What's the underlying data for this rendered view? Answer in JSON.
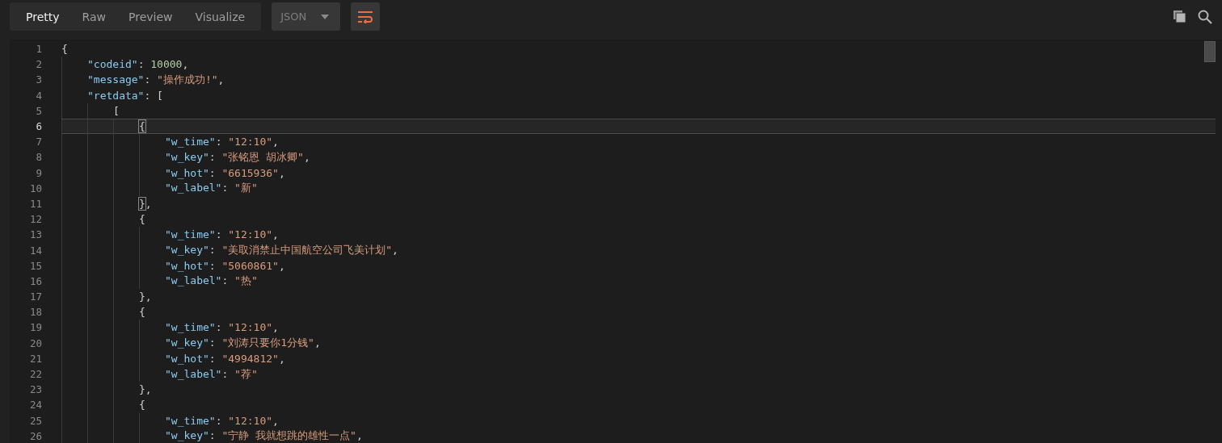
{
  "tabs": [
    {
      "label": "Pretty",
      "selected": true
    },
    {
      "label": "Raw",
      "selected": false
    },
    {
      "label": "Preview",
      "selected": false
    },
    {
      "label": "Visualize",
      "selected": false
    }
  ],
  "format_dropdown": {
    "value": "JSON"
  },
  "wrap_button": {
    "on": true
  },
  "code": {
    "lines": [
      {
        "number": "1",
        "current": false,
        "tokens": [
          {
            "kind": "punct",
            "text": "{"
          }
        ],
        "children": [
          {
            "number": "2",
            "current": false,
            "tokens": [
              {
                "kind": "key",
                "text": "\"codeid\""
              },
              {
                "kind": "punct",
                "text": ": "
              },
              {
                "kind": "number",
                "text": "10000"
              },
              {
                "kind": "punct",
                "text": ","
              }
            ]
          },
          {
            "number": "3",
            "current": false,
            "tokens": [
              {
                "kind": "key",
                "text": "\"message\""
              },
              {
                "kind": "punct",
                "text": ": "
              },
              {
                "kind": "string",
                "text": "\"操作成功!\""
              },
              {
                "kind": "punct",
                "text": ","
              }
            ]
          },
          {
            "number": "4",
            "current": false,
            "tokens": [
              {
                "kind": "key",
                "text": "\"retdata\""
              },
              {
                "kind": "punct",
                "text": ": ["
              }
            ],
            "children": [
              {
                "number": "5",
                "current": false,
                "tokens": [
                  {
                    "kind": "punct",
                    "text": "["
                  }
                ],
                "children": [
                  {
                    "number": "6",
                    "current": true,
                    "tokens": [
                      {
                        "kind": "match",
                        "text": "{"
                      }
                    ],
                    "children": [
                      {
                        "number": "7",
                        "current": false,
                        "tokens": [
                          {
                            "kind": "key",
                            "text": "\"w_time\""
                          },
                          {
                            "kind": "punct",
                            "text": ": "
                          },
                          {
                            "kind": "string",
                            "text": "\"12:10\""
                          },
                          {
                            "kind": "punct",
                            "text": ","
                          }
                        ]
                      },
                      {
                        "number": "8",
                        "current": false,
                        "tokens": [
                          {
                            "kind": "key",
                            "text": "\"w_key\""
                          },
                          {
                            "kind": "punct",
                            "text": ": "
                          },
                          {
                            "kind": "string",
                            "text": "\"张铭恩 胡冰卿\""
                          },
                          {
                            "kind": "punct",
                            "text": ","
                          }
                        ]
                      },
                      {
                        "number": "9",
                        "current": false,
                        "tokens": [
                          {
                            "kind": "key",
                            "text": "\"w_hot\""
                          },
                          {
                            "kind": "punct",
                            "text": ": "
                          },
                          {
                            "kind": "string",
                            "text": "\"6615936\""
                          },
                          {
                            "kind": "punct",
                            "text": ","
                          }
                        ]
                      },
                      {
                        "number": "10",
                        "current": false,
                        "tokens": [
                          {
                            "kind": "key",
                            "text": "\"w_label\""
                          },
                          {
                            "kind": "punct",
                            "text": ": "
                          },
                          {
                            "kind": "string",
                            "text": "\"新\""
                          }
                        ]
                      }
                    ]
                  },
                  {
                    "number": "11",
                    "current": false,
                    "tokens": [
                      {
                        "kind": "match",
                        "text": "}"
                      },
                      {
                        "kind": "punct",
                        "text": ","
                      }
                    ]
                  },
                  {
                    "number": "12",
                    "current": false,
                    "tokens": [
                      {
                        "kind": "punct",
                        "text": "{"
                      }
                    ],
                    "children": [
                      {
                        "number": "13",
                        "current": false,
                        "tokens": [
                          {
                            "kind": "key",
                            "text": "\"w_time\""
                          },
                          {
                            "kind": "punct",
                            "text": ": "
                          },
                          {
                            "kind": "string",
                            "text": "\"12:10\""
                          },
                          {
                            "kind": "punct",
                            "text": ","
                          }
                        ]
                      },
                      {
                        "number": "14",
                        "current": false,
                        "tokens": [
                          {
                            "kind": "key",
                            "text": "\"w_key\""
                          },
                          {
                            "kind": "punct",
                            "text": ": "
                          },
                          {
                            "kind": "string",
                            "text": "\"美取消禁止中国航空公司飞美计划\""
                          },
                          {
                            "kind": "punct",
                            "text": ","
                          }
                        ]
                      },
                      {
                        "number": "15",
                        "current": false,
                        "tokens": [
                          {
                            "kind": "key",
                            "text": "\"w_hot\""
                          },
                          {
                            "kind": "punct",
                            "text": ": "
                          },
                          {
                            "kind": "string",
                            "text": "\"5060861\""
                          },
                          {
                            "kind": "punct",
                            "text": ","
                          }
                        ]
                      },
                      {
                        "number": "16",
                        "current": false,
                        "tokens": [
                          {
                            "kind": "key",
                            "text": "\"w_label\""
                          },
                          {
                            "kind": "punct",
                            "text": ": "
                          },
                          {
                            "kind": "string",
                            "text": "\"热\""
                          }
                        ]
                      }
                    ]
                  },
                  {
                    "number": "17",
                    "current": false,
                    "tokens": [
                      {
                        "kind": "punct",
                        "text": "},"
                      }
                    ]
                  },
                  {
                    "number": "18",
                    "current": false,
                    "tokens": [
                      {
                        "kind": "punct",
                        "text": "{"
                      }
                    ],
                    "children": [
                      {
                        "number": "19",
                        "current": false,
                        "tokens": [
                          {
                            "kind": "key",
                            "text": "\"w_time\""
                          },
                          {
                            "kind": "punct",
                            "text": ": "
                          },
                          {
                            "kind": "string",
                            "text": "\"12:10\""
                          },
                          {
                            "kind": "punct",
                            "text": ","
                          }
                        ]
                      },
                      {
                        "number": "20",
                        "current": false,
                        "tokens": [
                          {
                            "kind": "key",
                            "text": "\"w_key\""
                          },
                          {
                            "kind": "punct",
                            "text": ": "
                          },
                          {
                            "kind": "string",
                            "text": "\"刘涛只要你1分钱\""
                          },
                          {
                            "kind": "punct",
                            "text": ","
                          }
                        ]
                      },
                      {
                        "number": "21",
                        "current": false,
                        "tokens": [
                          {
                            "kind": "key",
                            "text": "\"w_hot\""
                          },
                          {
                            "kind": "punct",
                            "text": ": "
                          },
                          {
                            "kind": "string",
                            "text": "\"4994812\""
                          },
                          {
                            "kind": "punct",
                            "text": ","
                          }
                        ]
                      },
                      {
                        "number": "22",
                        "current": false,
                        "tokens": [
                          {
                            "kind": "key",
                            "text": "\"w_label\""
                          },
                          {
                            "kind": "punct",
                            "text": ": "
                          },
                          {
                            "kind": "string",
                            "text": "\"荐\""
                          }
                        ]
                      }
                    ]
                  },
                  {
                    "number": "23",
                    "current": false,
                    "tokens": [
                      {
                        "kind": "punct",
                        "text": "},"
                      }
                    ]
                  },
                  {
                    "number": "24",
                    "current": false,
                    "tokens": [
                      {
                        "kind": "punct",
                        "text": "{"
                      }
                    ],
                    "children": [
                      {
                        "number": "25",
                        "current": false,
                        "tokens": [
                          {
                            "kind": "key",
                            "text": "\"w_time\""
                          },
                          {
                            "kind": "punct",
                            "text": ": "
                          },
                          {
                            "kind": "string",
                            "text": "\"12:10\""
                          },
                          {
                            "kind": "punct",
                            "text": ","
                          }
                        ]
                      },
                      {
                        "number": "26",
                        "current": false,
                        "tokens": [
                          {
                            "kind": "key",
                            "text": "\"w_key\""
                          },
                          {
                            "kind": "punct",
                            "text": ": "
                          },
                          {
                            "kind": "string",
                            "text": "\"宁静 我就想跳的雄性一点\""
                          },
                          {
                            "kind": "punct",
                            "text": ","
                          }
                        ]
                      }
                    ]
                  }
                ]
              }
            ]
          }
        ]
      }
    ]
  }
}
